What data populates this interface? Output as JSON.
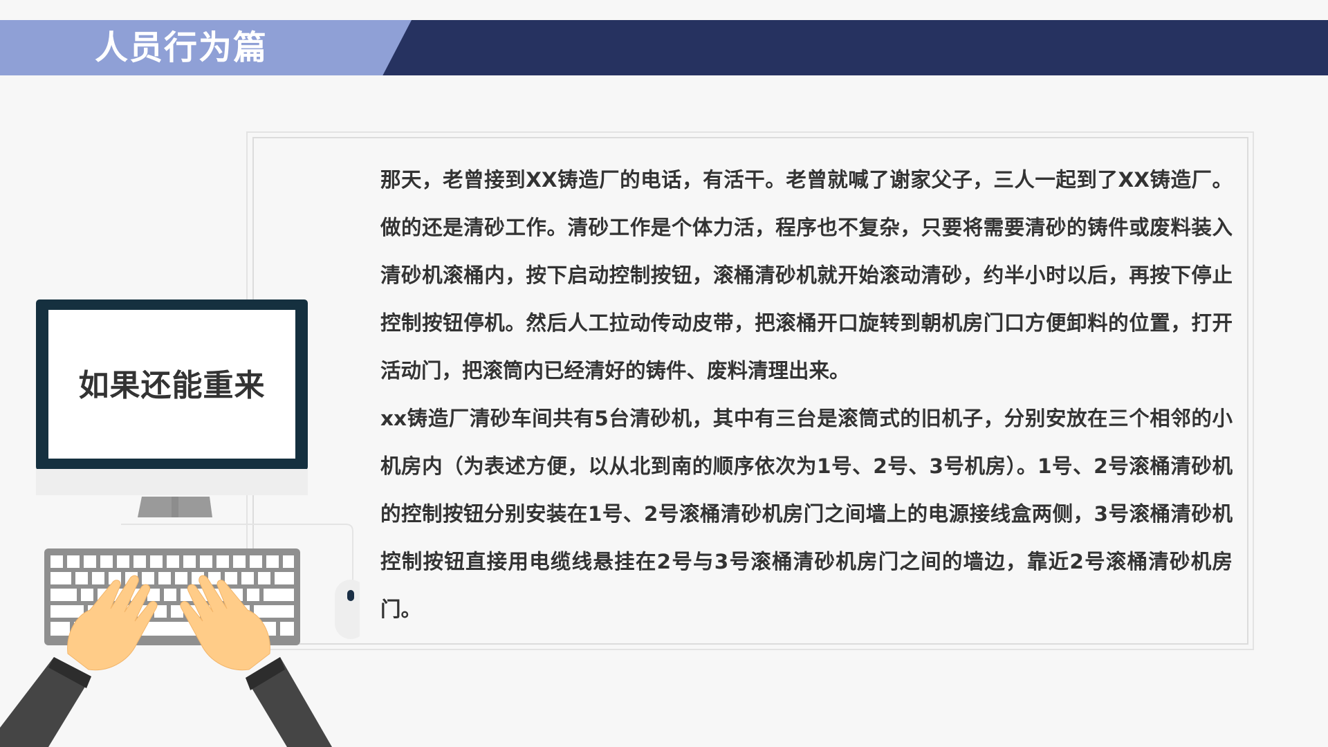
{
  "header": {
    "title": "人员行为篇",
    "colors": {
      "bar": "#263260",
      "tab": "#8fa0d6"
    }
  },
  "illustration": {
    "monitor_text": "如果还能重来",
    "icons": [
      "monitor-icon",
      "keyboard-icon",
      "mouse-icon",
      "hands-icon"
    ]
  },
  "article": {
    "paragraphs": [
      "那天，老曾接到XX铸造厂的电话，有活干。老曾就喊了谢家父子，三人一起到了XX铸造厂。做的还是清砂工作。清砂工作是个体力活，程序也不复杂，只要将需要清砂的铸件或废料装入清砂机滚桶内，按下启动控制按钮，滚桶清砂机就开始滚动清砂，约半小时以后，再按下停止控制按钮停机。然后人工拉动传动皮带，把滚桶开口旋转到朝机房门口方便卸料的位置，打开活动门，把滚筒内已经清好的铸件、废料清理出来。",
      "xx铸造厂清砂车间共有5台清砂机，其中有三台是滚筒式的旧机子，分别安放在三个相邻的小机房内（为表述方便，以从北到南的顺序依次为1号、2号、3号机房）。1号、2号滚桶清砂机的控制按钮分别安装在1号、2号滚桶清砂机房门之间墙上的电源接线盒两侧，3号滚桶清砂机控制按钮直接用电缆线悬挂在2号与3号滚桶清砂机房门之间的墙边，靠近2号滚桶清砂机房门。"
    ]
  }
}
